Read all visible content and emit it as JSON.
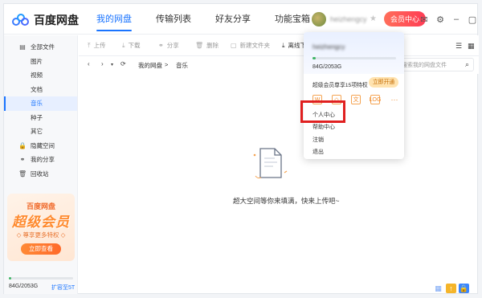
{
  "app": {
    "name": "百度网盘"
  },
  "nav": {
    "tabs": [
      "我的网盘",
      "传输列表",
      "好友分享",
      "功能宝箱"
    ]
  },
  "user": {
    "name": "heizhengcy",
    "vip_button": "会员中心"
  },
  "sidebar": {
    "items": [
      {
        "label": "全部文件",
        "icon": "▤"
      },
      {
        "label": "图片"
      },
      {
        "label": "视频"
      },
      {
        "label": "文档"
      },
      {
        "label": "音乐"
      },
      {
        "label": "种子"
      },
      {
        "label": "其它"
      },
      {
        "label": "隐藏空间",
        "icon": "🔒"
      },
      {
        "label": "我的分享",
        "icon": "⚭"
      },
      {
        "label": "回收站",
        "icon": "🗑"
      }
    ]
  },
  "promo": {
    "title": "百度网盘",
    "big": "超级会员",
    "subtitle": "◇ 尊享更多特权 ◇",
    "button": "立即查看"
  },
  "storage": {
    "text": "84G/2053G",
    "expand": "扩容至5T",
    "fraction": 0.04
  },
  "toolbar": {
    "upload": "上传",
    "download": "下载",
    "share": "分享",
    "delete": "删除",
    "new_folder": "新建文件夹",
    "offline": "离线下"
  },
  "path": {
    "root": "我的网盘",
    "sep": ">",
    "current": "音乐"
  },
  "search": {
    "placeholder": "搜索我的网盘文件"
  },
  "empty": {
    "message": "超大空间等你来填满，快来上传吧~"
  },
  "popup": {
    "username": "heizhengcy",
    "storage": "84G/2053G",
    "vip_text": "超级会员尊享15项特权",
    "open_button": "立即开通",
    "icons": [
      "W",
      "◇",
      "文",
      "LOG",
      "···"
    ],
    "menu": [
      "个人中心",
      "帮助中心",
      "注销",
      "退出"
    ]
  },
  "colors": {
    "accent": "#1a74ff",
    "vip": "#ff4b56",
    "promo": "#ff8a2e",
    "highlight": "#e02020",
    "storage": "#3fb565"
  }
}
